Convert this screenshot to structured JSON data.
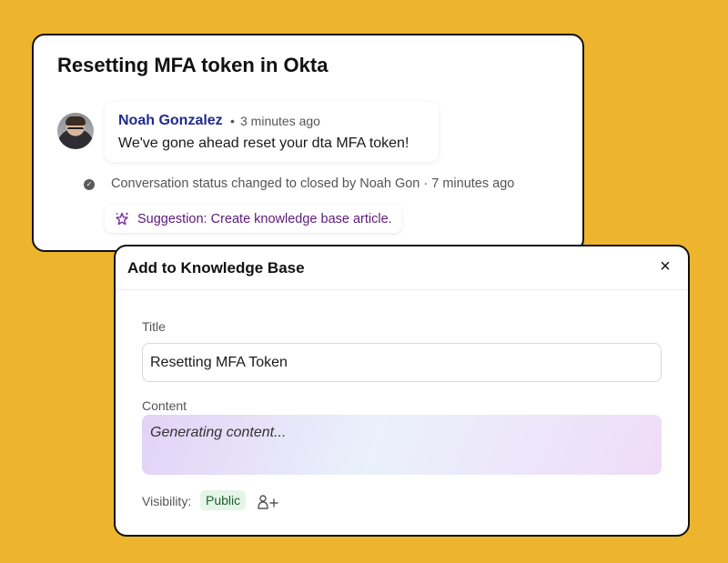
{
  "conversation": {
    "title": "Resetting MFA token in Okta",
    "author": "Noah Gonzalez",
    "separator": "•",
    "time": "3 minutes ago",
    "message": "We've gone ahead reset your dta MFA token!",
    "status": "Conversation status changed to closed by Noah Gon · 7   minutes ago",
    "suggestion": "Suggestion: Create knowledge base article."
  },
  "modal": {
    "title": "Add to Knowledge Base",
    "close_icon": "×",
    "title_label": "Title",
    "title_value": "Resetting MFA Token",
    "content_label": "Content",
    "content_placeholder": "Generating content...",
    "visibility_label": "Visibility:",
    "visibility_value": "Public"
  },
  "colors": {
    "background": "#EDB42E",
    "author": "#1f2b8e",
    "suggestion": "#5b1a7a",
    "public_badge_bg": "#e5f5e8",
    "public_badge_text": "#1d5f2a"
  },
  "icons": [
    "avatar",
    "status-check-icon",
    "suggestion-sparkle-icon",
    "close-icon",
    "add-person-icon"
  ]
}
